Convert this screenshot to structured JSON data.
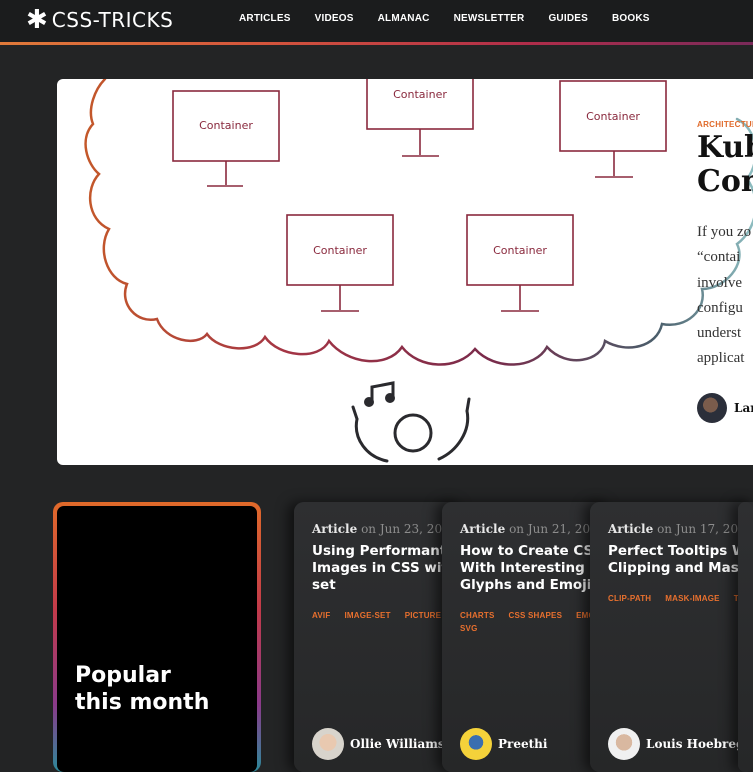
{
  "header": {
    "logo_text": "CSS-TRICKS",
    "logo_icon": "asterisk-star-icon",
    "nav": [
      "ARTICLES",
      "VIDEOS",
      "ALMANAC",
      "NEWSLETTER",
      "GUIDES",
      "BOOKS"
    ],
    "accent_gradient": [
      "#e07a3a",
      "#b02d4a",
      "#7a2a5a"
    ]
  },
  "hero": {
    "illustration_labels": [
      "Container",
      "Container",
      "Container",
      "Container",
      "Container"
    ],
    "kicker": "ARCHITECTUR",
    "title_lines": [
      "Kub",
      "Con"
    ],
    "excerpt_lines": [
      "If you zo",
      "“contai",
      "involve",
      "configu",
      "underst",
      "applicat"
    ],
    "author": "Lar"
  },
  "popular": {
    "title": "Popular this month"
  },
  "cards": [
    {
      "type": "Article",
      "date": "on Jun 23, 20",
      "title": "Using Performant Images in CSS with set",
      "tags": [
        "AVIF",
        "IMAGE-SET",
        "PICTURE"
      ],
      "author": "Ollie Williams"
    },
    {
      "type": "Article",
      "date": "on Jun 21, 20",
      "title": "How to Create CSS With Interesting S Glyphs and Emoji",
      "tags": [
        "CHARTS",
        "CSS SHAPES",
        "EMOJ",
        "SVG"
      ],
      "author": "Preethi"
    },
    {
      "type": "Article",
      "date": "on Jun 17, 20",
      "title": "Perfect Tooltips W Clipping and Mask",
      "tags": [
        "CLIP-PATH",
        "MASK-IMAGE",
        "TO"
      ],
      "author": "Louis Hoebreg"
    }
  ],
  "colors": {
    "page_bg": "#232425",
    "tag_orange": "#e8702e",
    "card_bg": "#2e2f31"
  }
}
